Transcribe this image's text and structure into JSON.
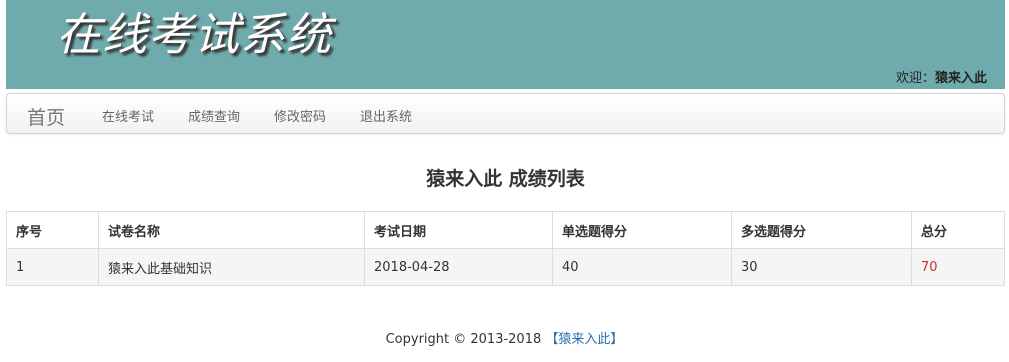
{
  "header": {
    "title": "在线考试系统",
    "welcome_label": "欢迎：",
    "username": "猿来入此"
  },
  "nav": {
    "brand": "首页",
    "items": [
      {
        "label": "在线考试"
      },
      {
        "label": "成绩查询"
      },
      {
        "label": "修改密码"
      },
      {
        "label": "退出系统"
      }
    ]
  },
  "main": {
    "heading": "猿来入此 成绩列表",
    "table": {
      "columns": [
        "序号",
        "试卷名称",
        "考试日期",
        "单选题得分",
        "多选题得分",
        "总分"
      ],
      "rows": [
        [
          "1",
          "猿来入此基础知识",
          "2018-04-28",
          "40",
          "30",
          "70"
        ]
      ]
    }
  },
  "footer": {
    "copyright": "Copyright © 2013-2018 ",
    "link": "【猿来入此】"
  },
  "colors": {
    "banner": "#6fabac",
    "total_score": "#c9302c",
    "footer_link": "#2a6fb0"
  }
}
